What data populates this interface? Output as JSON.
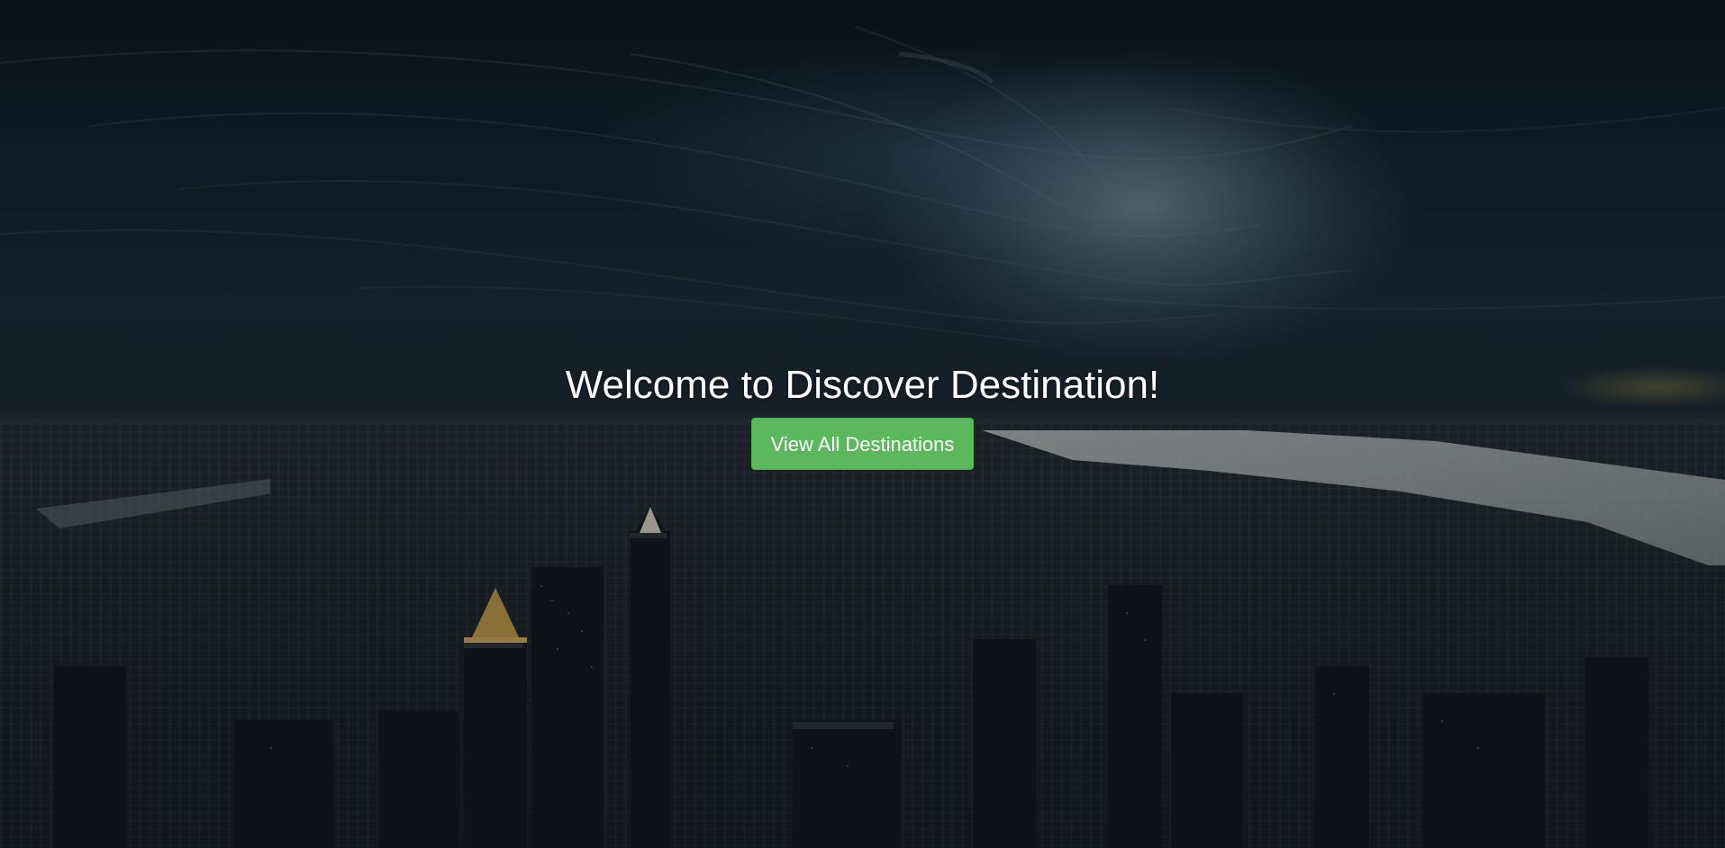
{
  "hero": {
    "title": "Welcome to Discover Destination!",
    "button_label": "View All Destinations"
  },
  "colors": {
    "button_bg": "#5cb85c",
    "button_border": "#4cae4c",
    "title_text": "#ffffff"
  }
}
